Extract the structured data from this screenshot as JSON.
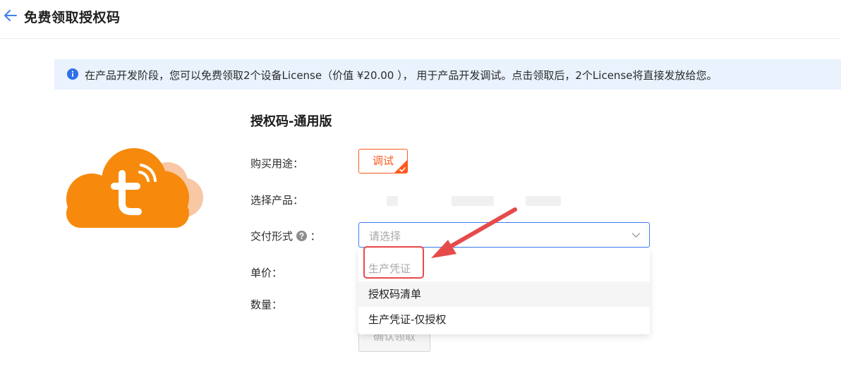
{
  "header": {
    "back_icon": "arrow-left-icon",
    "title": "免费领取授权码"
  },
  "notice": {
    "icon": "info-icon",
    "text": "在产品开发阶段，您可以免费领取2个设备License（价值 ¥20.00 ），  用于产品开发调试。点击领取后，2个License将直接发放给您。"
  },
  "product": {
    "logo_icon": "tuya-cloud-logo",
    "title": "授权码-通用版"
  },
  "form": {
    "purpose_label": "购买用途：",
    "purpose_option": "调试",
    "product_label": "选择产品：",
    "delivery_label": "交付形式",
    "delivery_colon": "：",
    "delivery_placeholder": "请选择",
    "price_label": "单价：",
    "quantity_label": "数量：",
    "confirm_label": "确认领取"
  },
  "dropdown": {
    "options": [
      {
        "label": "生产凭证",
        "disabled": true
      },
      {
        "label": "授权码清单",
        "disabled": false
      },
      {
        "label": "生产凭证-仅授权",
        "disabled": false
      }
    ]
  },
  "colors": {
    "accent_orange": "#ff5a1f",
    "focus_blue": "#3d7ff0",
    "notice_bg": "#e9f2fd",
    "annotation_red": "#e74a4a"
  }
}
